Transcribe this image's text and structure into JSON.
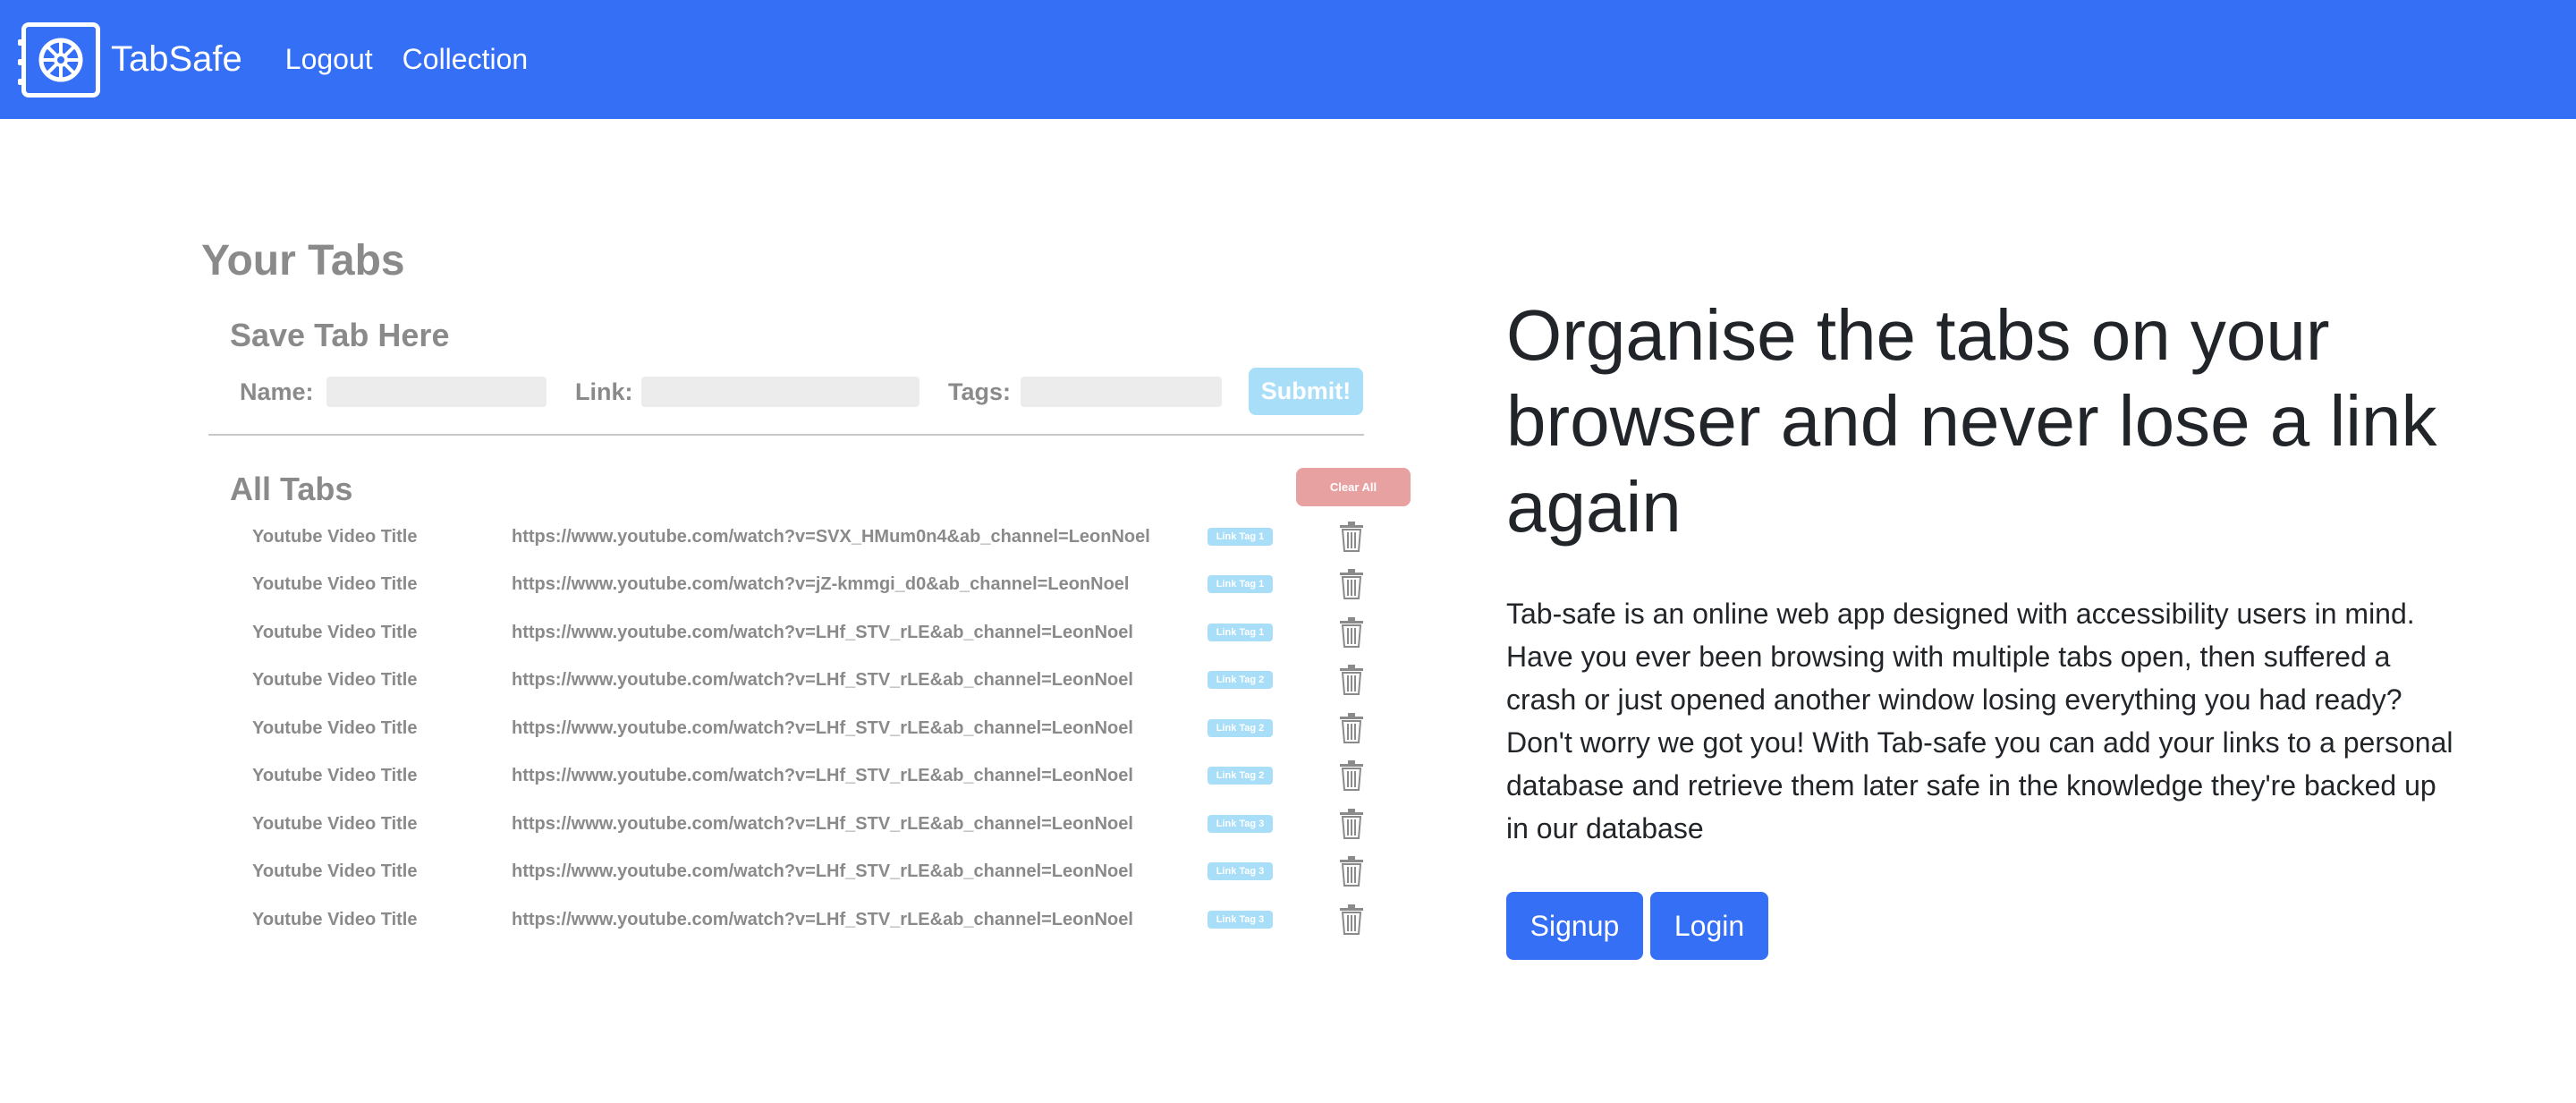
{
  "nav": {
    "brand": "TabSafe",
    "links": [
      "Logout",
      "Collection"
    ]
  },
  "mock": {
    "your_tabs": "Your Tabs",
    "save_title": "Save Tab Here",
    "name_label": "Name:",
    "link_label": "Link:",
    "tags_label": "Tags:",
    "submit": "Submit!",
    "all_tabs": "All Tabs",
    "clear_all": "Clear All",
    "rows": [
      {
        "title": "Youtube Video Title",
        "url": "https://www.youtube.com/watch?v=SVX_HMum0n4&ab_channel=LeonNoel",
        "tag": "Link Tag 1"
      },
      {
        "title": "Youtube Video Title",
        "url": "https://www.youtube.com/watch?v=jZ-kmmgi_d0&ab_channel=LeonNoel",
        "tag": "Link Tag 1"
      },
      {
        "title": "Youtube Video Title",
        "url": "https://www.youtube.com/watch?v=LHf_STV_rLE&ab_channel=LeonNoel",
        "tag": "Link Tag 1"
      },
      {
        "title": "Youtube Video Title",
        "url": "https://www.youtube.com/watch?v=LHf_STV_rLE&ab_channel=LeonNoel",
        "tag": "Link Tag 2"
      },
      {
        "title": "Youtube Video Title",
        "url": "https://www.youtube.com/watch?v=LHf_STV_rLE&ab_channel=LeonNoel",
        "tag": "Link Tag 2"
      },
      {
        "title": "Youtube Video Title",
        "url": "https://www.youtube.com/watch?v=LHf_STV_rLE&ab_channel=LeonNoel",
        "tag": "Link Tag 2"
      },
      {
        "title": "Youtube Video Title",
        "url": "https://www.youtube.com/watch?v=LHf_STV_rLE&ab_channel=LeonNoel",
        "tag": "Link Tag 3"
      },
      {
        "title": "Youtube Video Title",
        "url": "https://www.youtube.com/watch?v=LHf_STV_rLE&ab_channel=LeonNoel",
        "tag": "Link Tag 3"
      },
      {
        "title": "Youtube Video Title",
        "url": "https://www.youtube.com/watch?v=LHf_STV_rLE&ab_channel=LeonNoel",
        "tag": "Link Tag 3"
      }
    ]
  },
  "hero": {
    "title": "Organise the tabs on your browser and never lose a link again",
    "description": "Tab-safe is an online web app designed with accessibility users in mind. Have you ever been browsing with multiple tabs open, then suffered a crash or just opened another window losing everything you had ready? Don't worry we got you! With Tab-safe you can add your links to a personal database and retrieve them later safe in the knowledge they're backed up in our database",
    "signup": "Signup",
    "login": "Login"
  },
  "colors": {
    "primary": "#356ff5",
    "text": "#212529",
    "mock_text": "#8a8a8a",
    "mock_submit": "#a8def7",
    "mock_clear": "#e8a1a1"
  }
}
